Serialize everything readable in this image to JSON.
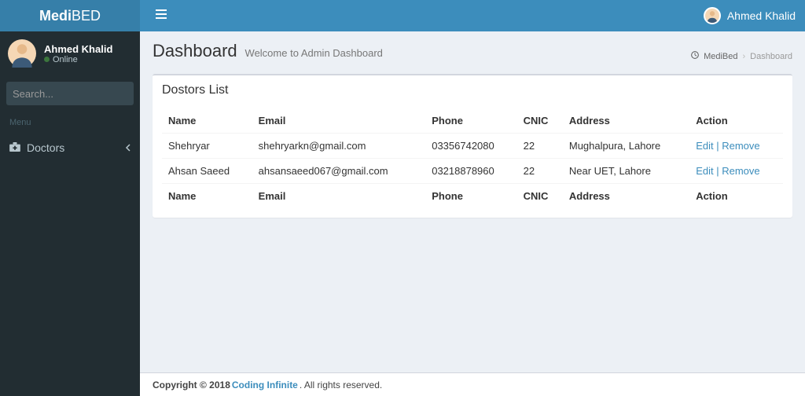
{
  "brand": {
    "bold": "Medi",
    "light": "BED"
  },
  "topbar": {
    "user_name": "Ahmed Khalid"
  },
  "sidebar": {
    "user_name": "Ahmed Khalid",
    "status_label": "Online",
    "search_placeholder": "Search...",
    "menu_header": "Menu",
    "items": [
      {
        "label": "Doctors"
      }
    ]
  },
  "content": {
    "title": "Dashboard",
    "subtitle": "Welcome to Admin Dashboard",
    "breadcrumb_root": "MediBed",
    "breadcrumb_current": "Dashboard",
    "box_title": "Dostors List",
    "columns": {
      "name": "Name",
      "email": "Email",
      "phone": "Phone",
      "cnic": "CNIC",
      "address": "Address",
      "action": "Action"
    },
    "rows": [
      {
        "name": "Shehryar",
        "email": "shehryarkn@gmail.com",
        "phone": "03356742080",
        "cnic": "22",
        "address": "Mughalpura, Lahore"
      },
      {
        "name": "Ahsan Saeed",
        "email": "ahsansaeed067@gmail.com",
        "phone": "03218878960",
        "cnic": "22",
        "address": "Near UET, Lahore"
      }
    ],
    "action_edit": "Edit",
    "action_remove": "Remove"
  },
  "footer": {
    "copyright_prefix": "Copyright © 2018 ",
    "link": "Coding Infinite",
    "suffix": ". All rights reserved."
  }
}
